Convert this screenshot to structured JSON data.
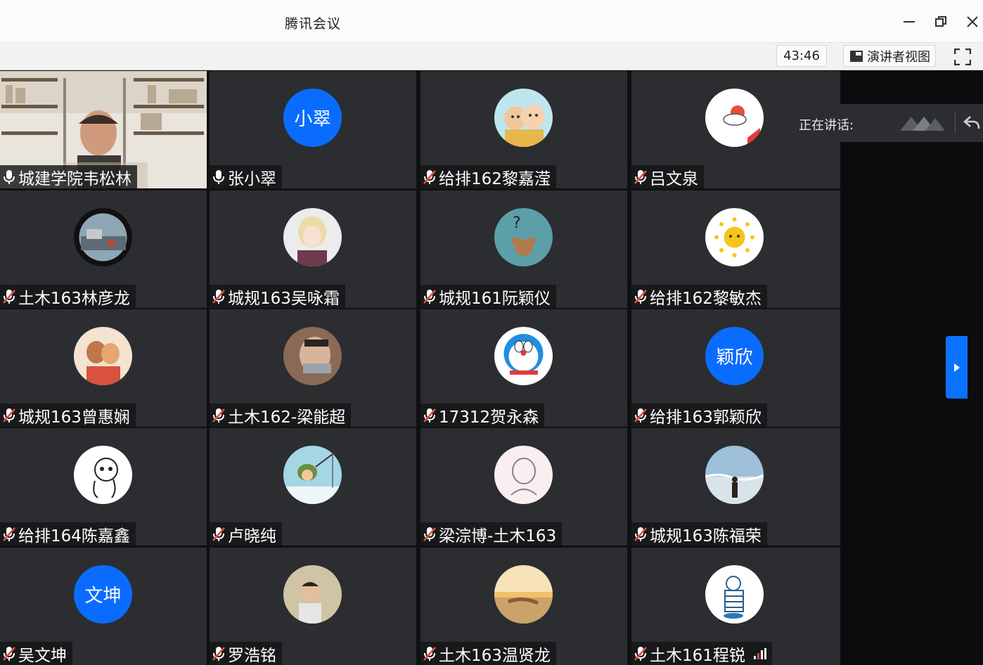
{
  "window": {
    "title": "腾讯会议",
    "controls": [
      "minimize-icon",
      "restore-icon",
      "close-icon"
    ]
  },
  "toolbar": {
    "timer": "43:46",
    "view_label": "演讲者视图",
    "fullscreen_icon": "fullscreen-icon"
  },
  "speaking": {
    "label": "正在讲话:"
  },
  "colors": {
    "accent": "#0a6cff",
    "tile": "#2b2d31",
    "muted": "#e34c3c"
  },
  "participants": [
    {
      "name": "城建学院韦松林",
      "mic": "on",
      "avatar": "video"
    },
    {
      "name": "张小翠",
      "mic": "on",
      "avatar": "text",
      "avatar_text": "小翠"
    },
    {
      "name": "给排162黎嘉滢",
      "mic": "muted",
      "avatar": "cartoon-kids"
    },
    {
      "name": "吕文泉",
      "mic": "muted",
      "avatar": "cloud-sun"
    },
    {
      "name": "土木163林彦龙",
      "mic": "muted",
      "avatar": "photo-street"
    },
    {
      "name": "城规163吴咏霜",
      "mic": "muted",
      "avatar": "anime-girl"
    },
    {
      "name": "城规161阮颖仪",
      "mic": "muted",
      "avatar": "mouse-question"
    },
    {
      "name": "给排162黎敏杰",
      "mic": "muted",
      "avatar": "sun-face"
    },
    {
      "name": "城规163曾惠娴",
      "mic": "muted",
      "avatar": "illustration-couple"
    },
    {
      "name": "土木162-梁能超",
      "mic": "muted",
      "avatar": "selfie"
    },
    {
      "name": "17312贺永森",
      "mic": "muted",
      "avatar": "doraemon"
    },
    {
      "name": "给排163郭颖欣",
      "mic": "muted",
      "avatar": "text",
      "avatar_text": "颖欣"
    },
    {
      "name": "给排164陈嘉鑫",
      "mic": "muted",
      "avatar": "doodle-face"
    },
    {
      "name": "卢晓纯",
      "mic": "muted",
      "avatar": "fishing-frog"
    },
    {
      "name": "梁淙博-土木163",
      "mic": "muted",
      "avatar": "sketch-girl"
    },
    {
      "name": "城规163陈福荣",
      "mic": "muted",
      "avatar": "beach-person"
    },
    {
      "name": "吴文坤",
      "mic": "muted",
      "avatar": "text",
      "avatar_text": "文坤"
    },
    {
      "name": "罗浩铭",
      "mic": "muted",
      "avatar": "baby-photo"
    },
    {
      "name": "土木163温贤龙",
      "mic": "muted",
      "avatar": "sunset-hands"
    },
    {
      "name": "土木161程锐",
      "mic": "muted",
      "avatar": "sailor-boy",
      "signal": true
    }
  ]
}
